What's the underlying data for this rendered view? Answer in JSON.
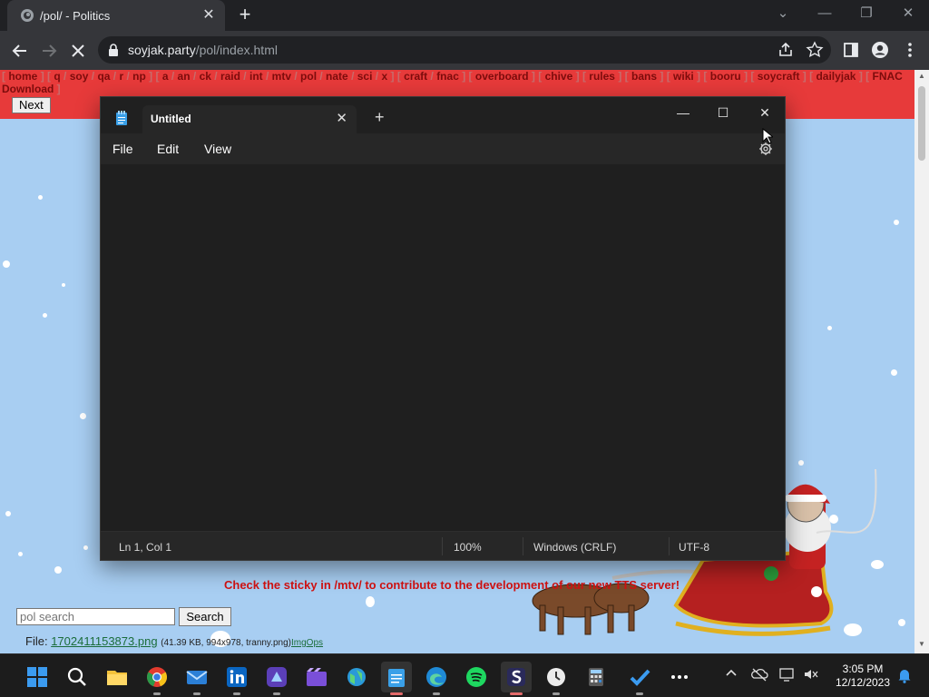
{
  "browser": {
    "tab_title": "/pol/ - Politics",
    "tab_close": "✕",
    "new_tab": "+",
    "url_host": "soyjak.party",
    "url_path": "/pol/index.html"
  },
  "boardlist": [
    {
      "label": "home"
    },
    {
      "label": "q"
    },
    {
      "label": "soy"
    },
    {
      "label": "qa"
    },
    {
      "label": "r"
    },
    {
      "label": "np"
    },
    {
      "label": "a"
    },
    {
      "label": "an"
    },
    {
      "label": "ck"
    },
    {
      "label": "raid"
    },
    {
      "label": "int"
    },
    {
      "label": "mtv"
    },
    {
      "label": "pol"
    },
    {
      "label": "nate"
    },
    {
      "label": "sci"
    },
    {
      "label": "x"
    },
    {
      "label": "craft"
    },
    {
      "label": "fnac"
    },
    {
      "label": "overboard"
    },
    {
      "label": "chive"
    },
    {
      "label": "rules"
    },
    {
      "label": "bans"
    },
    {
      "label": "wiki"
    },
    {
      "label": "booru"
    },
    {
      "label": "soycraft"
    },
    {
      "label": "dailyjak"
    },
    {
      "label": "FNAC Download"
    }
  ],
  "page": {
    "next_button": "Next",
    "sticky_message": "Check the sticky in /mtv/ to contribute to the development of our new TTS server!",
    "search_placeholder": "pol search",
    "search_button": "Search",
    "file_label": "File:",
    "file_name": "1702411153873.png",
    "file_meta": "(41.39 KB, 994x978, tranny.png)",
    "file_imgops": "ImgOps"
  },
  "notepad": {
    "tab_title": "Untitled",
    "tab_close": "✕",
    "new_tab": "+",
    "menu": {
      "file": "File",
      "edit": "Edit",
      "view": "View"
    },
    "status": {
      "position": "Ln 1, Col 1",
      "zoom": "100%",
      "line_ending": "Windows (CRLF)",
      "encoding": "UTF-8"
    }
  },
  "taskbar": {
    "apps": [
      "start-icon",
      "search-icon",
      "file-explorer-icon",
      "chrome-icon",
      "mail-icon",
      "linkedin-icon",
      "clipchamp-icon",
      "movies-icon",
      "maps-icon",
      "notepad-icon",
      "edge-icon",
      "spotify-icon",
      "soyjak-app-icon",
      "clock-app-icon",
      "calculator-icon",
      "todo-icon",
      "more-icon"
    ],
    "time": "3:05 PM",
    "date": "12/12/2023"
  },
  "colors": {
    "board_bar": "#e73a3a",
    "page_bg": "#a8cef2",
    "notepad_bg": "#272727",
    "taskbar_bg": "#1c1c1c"
  }
}
